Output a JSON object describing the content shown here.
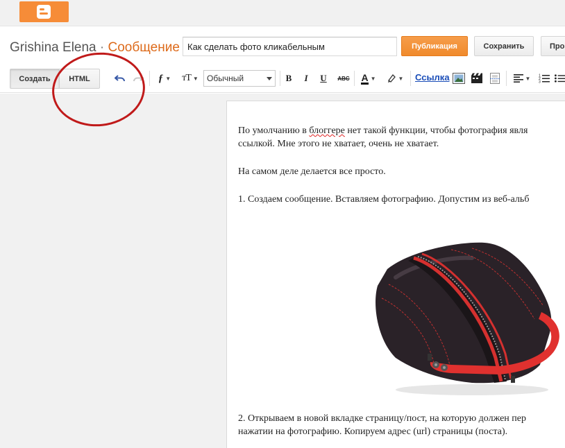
{
  "topbar": {
    "logo_icon": "blogger-logo-icon",
    "brand_color": "#f68c38"
  },
  "header": {
    "blog_name": "Grishina Elena",
    "separator": "·",
    "section": "Сообщение",
    "title_value": "Как сделать фото кликабельным",
    "publish_label": "Публикация",
    "save_label": "Сохранить",
    "preview_label": "Про"
  },
  "toolbar": {
    "mode_create": "Создать",
    "mode_html": "HTML",
    "undo_icon": "undo-icon",
    "redo_icon": "redo-icon",
    "font_family_icon": "font-family-icon",
    "font_size_icon": "font-size-icon",
    "format_value": "Обычный",
    "bold_label": "B",
    "italic_label": "I",
    "underline_label": "U",
    "strikethrough_label": "ABC",
    "text_color_label": "A",
    "link_label": "Ссылка",
    "accent_color": "#dd6a1a",
    "annotation_color": "#c01a1a"
  },
  "post": {
    "para1_line1_a": "По умолчанию в ",
    "para1_line1_misspelled": "блоггере",
    "para1_line1_b": " нет такой функции, чтобы фотография явля",
    "para1_line2": "ссылкой. Мне этого не хватает, очень не хватает.",
    "para2": "На самом деле делается все просто.",
    "para3": "1. Создаем сообщение. Вставляем фотографию. Допустим из веб-альб",
    "para4_line1": "2. Открываем в новой вкладке страницу/пост, на которую должен пер",
    "para4_line2": "нажатии на фотографию. Копируем адрес (url) страницы (поста)."
  }
}
